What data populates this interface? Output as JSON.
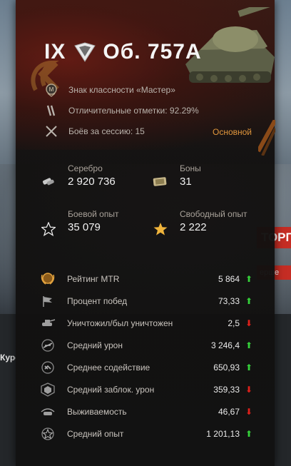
{
  "background": {
    "right_banner_text": "ТОРГОВЫЙ К",
    "right_sub_text": "ерше",
    "left_tab_text": "Курс"
  },
  "header": {
    "tier": "IX",
    "tank_name": "Об. 757А",
    "mastery_label": "Знак классности «Мастер»",
    "marks_label": "Отличительные отметки: 92.29%",
    "battles_label": "Боёв за сессию: 15",
    "mode_label": "Основной"
  },
  "currencies": {
    "silver_label": "Серебро",
    "silver_value": "2 920 736",
    "bonds_label": "Боны",
    "bonds_value": "31",
    "battle_xp_label": "Боевой опыт",
    "battle_xp_value": "35 079",
    "free_xp_label": "Свободный опыт",
    "free_xp_value": "2 222"
  },
  "stats": [
    {
      "icon": "mtr-rating-icon",
      "label": "Рейтинг MTR",
      "value": "5 864",
      "trend": "up",
      "arrow": "⬆"
    },
    {
      "icon": "flag-icon",
      "label": "Процент побед",
      "value": "73,33",
      "trend": "up",
      "arrow": "⬆"
    },
    {
      "icon": "destroyed-icon",
      "label": "Уничтожил/был уничтожен",
      "value": "2,5",
      "trend": "down",
      "arrow": "⬇"
    },
    {
      "icon": "damage-icon",
      "label": "Средний урон",
      "value": "3 246,4",
      "trend": "up",
      "arrow": "⬆"
    },
    {
      "icon": "assist-icon",
      "label": "Среднее содействие",
      "value": "650,93",
      "trend": "up",
      "arrow": "⬆"
    },
    {
      "icon": "blocked-damage-icon",
      "label": "Средний заблок. урон",
      "value": "359,33",
      "trend": "down",
      "arrow": "⬇"
    },
    {
      "icon": "survival-icon",
      "label": "Выживаемость",
      "value": "46,67",
      "trend": "down",
      "arrow": "⬇"
    },
    {
      "icon": "avg-xp-icon",
      "label": "Средний опыт",
      "value": "1 201,13",
      "trend": "up",
      "arrow": "⬆"
    }
  ],
  "colors": {
    "accent_orange": "#e0963c",
    "trend_up": "#35d23a",
    "trend_down": "#e0211b"
  }
}
